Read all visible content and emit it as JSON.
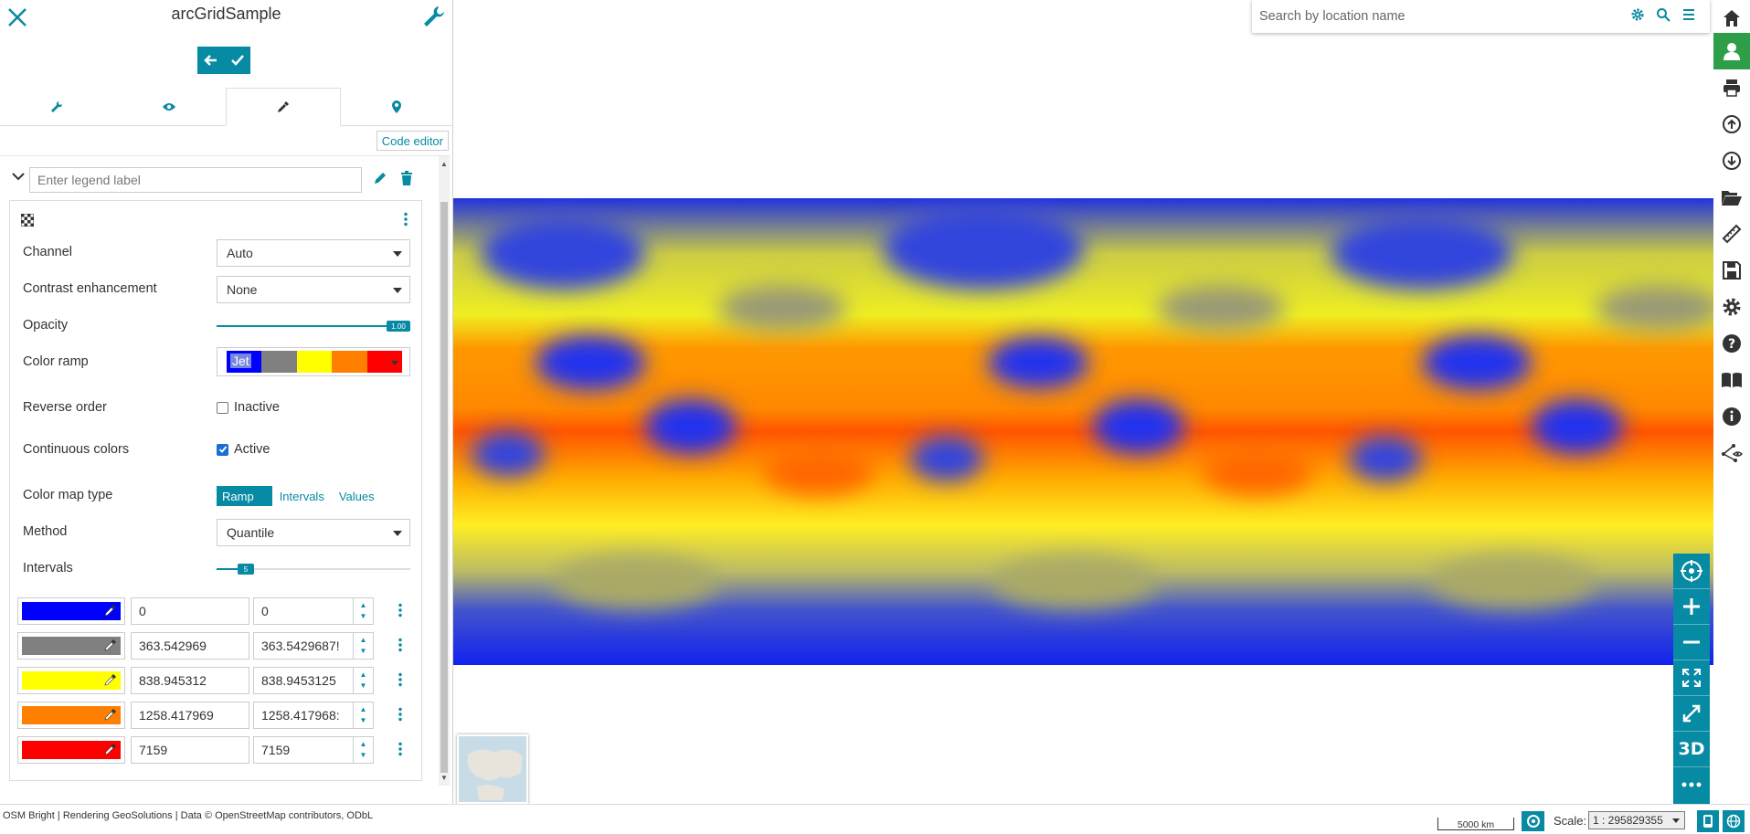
{
  "panel": {
    "title": "arcGridSample",
    "code_editor_label": "Code editor",
    "legend_placeholder": "Enter legend label"
  },
  "form": {
    "channel_label": "Channel",
    "channel_value": "Auto",
    "contrast_label": "Contrast enhancement",
    "contrast_value": "None",
    "opacity_label": "Opacity",
    "opacity_value": "1.00",
    "opacity_fraction": 1.0,
    "ramp_label": "Color ramp",
    "ramp_value": "Jet",
    "ramp_colors": [
      "#0000ff",
      "#808080",
      "#ffff00",
      "#ff8000",
      "#ff0000"
    ],
    "reverse_label": "Reverse order",
    "reverse_state": "Inactive",
    "continuous_label": "Continuous colors",
    "continuous_state": "Active",
    "cmtype_label": "Color map type",
    "cmtype_options": [
      "Ramp",
      "Intervals",
      "Values"
    ],
    "method_label": "Method",
    "method_value": "Quantile",
    "intervals_label": "Intervals",
    "intervals_value": "5",
    "intervals_fraction": 0.15
  },
  "entries": [
    {
      "color": "#0000ff",
      "quantity": "0",
      "label": "0"
    },
    {
      "color": "#808080",
      "quantity": "363.542969",
      "label": "363.5429687!"
    },
    {
      "color": "#ffff00",
      "quantity": "838.945312",
      "label": "838.9453125"
    },
    {
      "color": "#ff8000",
      "quantity": "1258.417969",
      "label": "1258.417968:"
    },
    {
      "color": "#ff0000",
      "quantity": "7159",
      "label": "7159"
    }
  ],
  "search": {
    "placeholder": "Search by location name"
  },
  "map": {
    "ctl_3d_label": "3D"
  },
  "footer": {
    "attribution": "OSM Bright | Rendering GeoSolutions | Data © OpenStreetMap contributors, ODbL",
    "scalebar": "5000 km",
    "scale_label": "Scale:",
    "scale_value": "1 : 295829355"
  },
  "colors": {
    "accent": "#078aa3",
    "sidebar_active": "#2e9e48"
  }
}
